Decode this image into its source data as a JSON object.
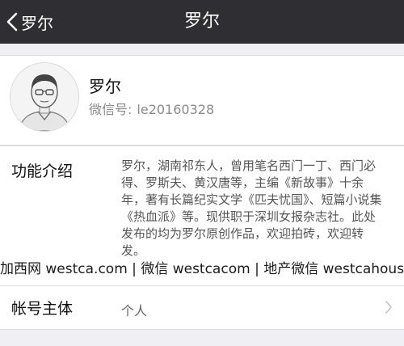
{
  "navbar": {
    "back_label": "罗尔",
    "title": "罗尔"
  },
  "profile": {
    "name": "罗尔",
    "wechat_label": "微信号:",
    "wechat_id": "le20160328"
  },
  "intro": {
    "label": "功能介绍",
    "text": "罗尔，湖南祁东人，曾用笔名西门一丁、西门必得、罗斯夫、黄汉唐等，主编《新故事》十余年，著有长篇纪实文学《匹夫忧国》、短篇小说集《热血派》等。现供职于深圳女报杂志社。此处发布的均为罗尔原创作品，欢迎拍砖，欢迎转发。"
  },
  "owner": {
    "label": "帐号主体",
    "value": "个人"
  },
  "watermark": {
    "text": "加西网 westca.com | 微信 westcacom | 地产微信 westcahouse"
  },
  "icons": {
    "back": "chevron-left-icon",
    "row_arrow": "chevron-right-icon",
    "avatar": "avatar-sketch"
  },
  "colors": {
    "navbar_bg": "#2f2f33",
    "page_bg": "#efeff4",
    "card_bg": "#ffffff",
    "secondary_text": "#8a8a8a"
  }
}
